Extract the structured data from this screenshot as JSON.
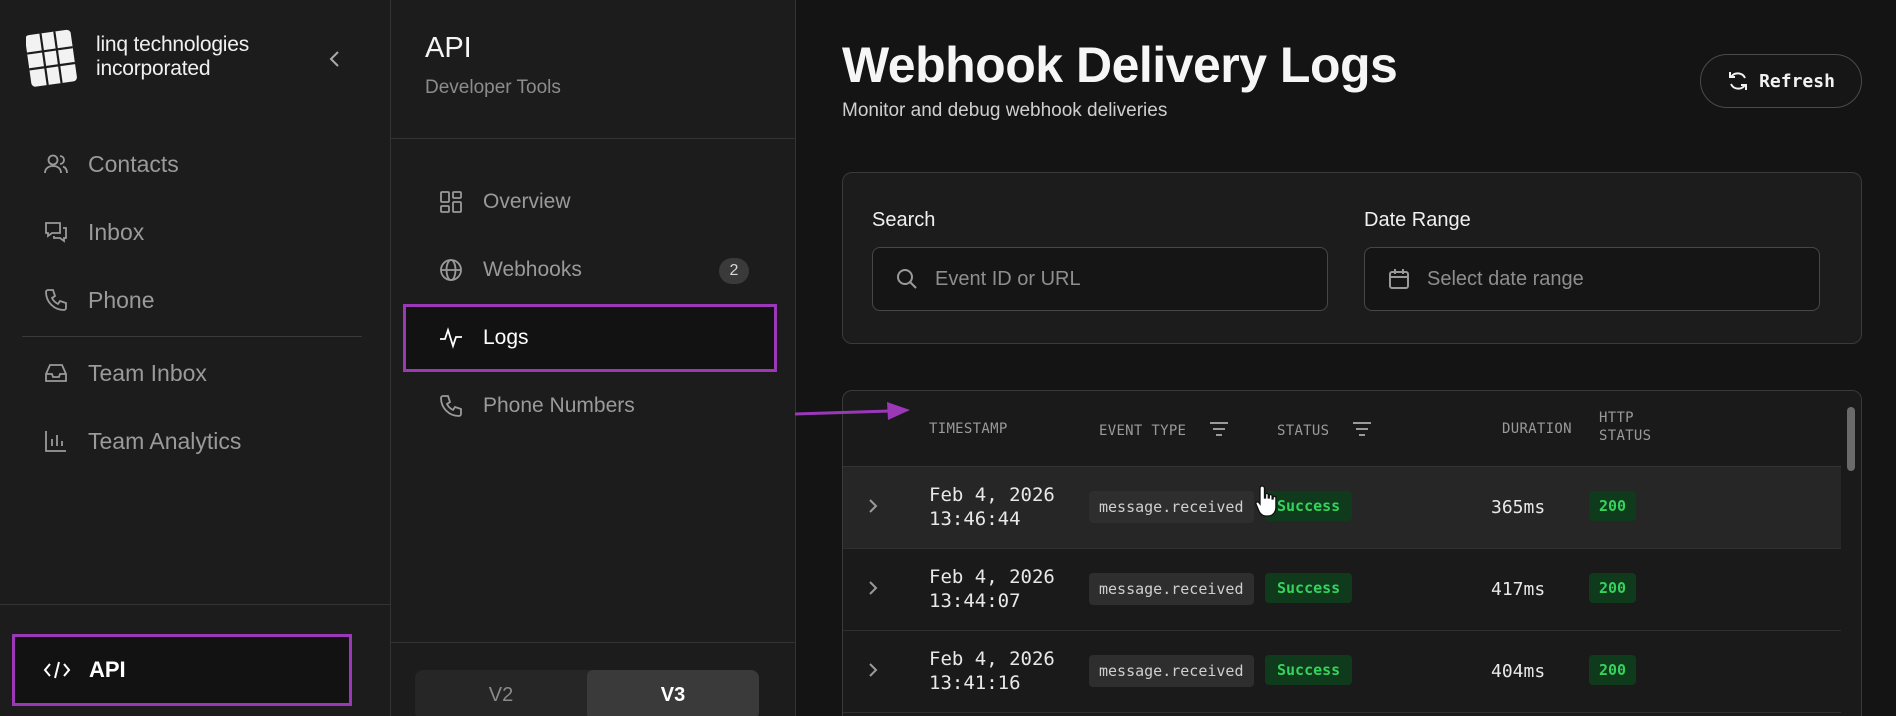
{
  "brand": {
    "name": "linq technologies incorporated"
  },
  "sidebar": {
    "items": [
      {
        "label": "Contacts",
        "icon": "users-icon"
      },
      {
        "label": "Inbox",
        "icon": "chat-icon"
      },
      {
        "label": "Phone",
        "icon": "phone-icon"
      }
    ],
    "items_secondary": [
      {
        "label": "Team Inbox",
        "icon": "inbox-tray-icon"
      },
      {
        "label": "Team Analytics",
        "icon": "bar-chart-icon"
      }
    ],
    "api_label": "API"
  },
  "subpanel": {
    "title": "API",
    "subtitle": "Developer Tools",
    "items": [
      {
        "label": "Overview",
        "icon": "grid-icon"
      },
      {
        "label": "Webhooks",
        "icon": "globe-icon",
        "badge": "2"
      },
      {
        "label": "Logs",
        "icon": "activity-icon"
      },
      {
        "label": "Phone Numbers",
        "icon": "phone-icon"
      }
    ],
    "versions": [
      "V2",
      "V3"
    ],
    "active_version": "V3"
  },
  "main": {
    "title": "Webhook Delivery Logs",
    "subtitle": "Monitor and debug webhook deliveries",
    "refresh_label": "Refresh",
    "filters": {
      "search_label": "Search",
      "search_placeholder": "Event ID or URL",
      "date_label": "Date Range",
      "date_placeholder": "Select date range"
    },
    "table": {
      "headers": {
        "timestamp": "TIMESTAMP",
        "event_type": "EVENT TYPE",
        "status": "STATUS",
        "duration": "DURATION",
        "http_status_1": "HTTP",
        "http_status_2": "STATUS"
      },
      "rows": [
        {
          "date": "Feb 4, 2026",
          "time": "13:46:44",
          "event": "message.received",
          "status": "Success",
          "duration": "365ms",
          "http": "200"
        },
        {
          "date": "Feb 4, 2026",
          "time": "13:44:07",
          "event": "message.received",
          "status": "Success",
          "duration": "417ms",
          "http": "200"
        },
        {
          "date": "Feb 4, 2026",
          "time": "13:41:16",
          "event": "message.received",
          "status": "Success",
          "duration": "404ms",
          "http": "200"
        }
      ]
    }
  },
  "colors": {
    "highlight": "#9a38b8",
    "success_text": "#35d25c",
    "success_bg": "#0f3a1b",
    "background": "#141414"
  }
}
